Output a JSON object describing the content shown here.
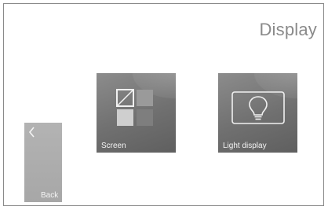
{
  "header": {
    "title": "Display"
  },
  "tiles": [
    {
      "label": "Screen",
      "icon": "screen-layout-icon"
    },
    {
      "label": "Light display",
      "icon": "light-bulb-icon"
    }
  ],
  "back": {
    "label": "Back",
    "icon": "chevron-left-icon"
  }
}
